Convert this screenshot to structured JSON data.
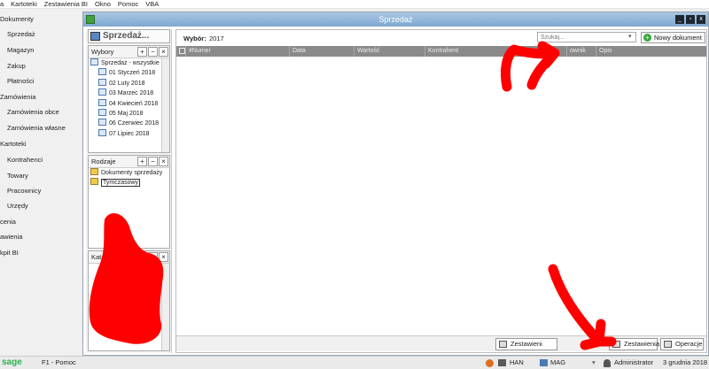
{
  "menubar": {
    "items": [
      "a",
      "Kartoteki",
      "Zestawienia BI",
      "Okno",
      "Pomoc",
      "VBA"
    ]
  },
  "nav": {
    "sections": [
      {
        "label": "Dokumenty",
        "items": [
          "Sprzedaż",
          "Magazyn",
          "Zakup",
          "Płatności"
        ]
      },
      {
        "label": "Zamówienia",
        "items": [
          "Zamówienia obce",
          "Zamówienia własne"
        ]
      },
      {
        "label": "Kartoteki",
        "items": [
          "Kontrahenci",
          "Towary",
          "Pracownicy",
          "Urzędy"
        ]
      },
      {
        "label": "cenia",
        "items": []
      },
      {
        "label": "awienia",
        "items": []
      },
      {
        "label": "kpit BI",
        "items": []
      }
    ]
  },
  "window": {
    "title": "Sprzedaż",
    "buttons": [
      "_",
      "▫",
      "x"
    ]
  },
  "left": {
    "big_button": "Sprzedaż...",
    "wybory": {
      "header": "Wybory",
      "items": [
        "Sprzedaż - wszystkie",
        "01 Styczeń 2018",
        "02 Luty 2018",
        "03 Marzec 2018",
        "04 Kwiecień 2018",
        "05 Maj 2018",
        "06 Czerwiec 2018",
        "07 Lipiec 2018"
      ]
    },
    "rodzaje": {
      "header": "Rodzaje",
      "items": [
        "Dokumenty sprzedaży",
        "Tymczasowy"
      ]
    },
    "katalogi": {
      "header": "Katalo"
    },
    "panel_buttons": [
      "+",
      "−",
      "×"
    ]
  },
  "main": {
    "wybor_label": "Wybór:",
    "wybor_value": "2017",
    "search_placeholder": "Szukaj...",
    "new_doc_label": "Nowy dokument",
    "columns": [
      "#Numer",
      "Data",
      "Wartość",
      "Kontrahent",
      "ownik",
      "Opis"
    ],
    "bottom_buttons": [
      "Zestawieni",
      "Zestawienia",
      "Operacje"
    ]
  },
  "status": {
    "logo": "sage",
    "help": "F1 - Pomoc",
    "han": "HAN",
    "mag": "MAG",
    "user": "Administrator",
    "date": "3 grudnia 2018"
  },
  "colors": {
    "titlebar": "#8fb4da",
    "grid_header": "#8a8a8a",
    "sage_green": "#2db34a",
    "annotation": "#ff0000"
  }
}
